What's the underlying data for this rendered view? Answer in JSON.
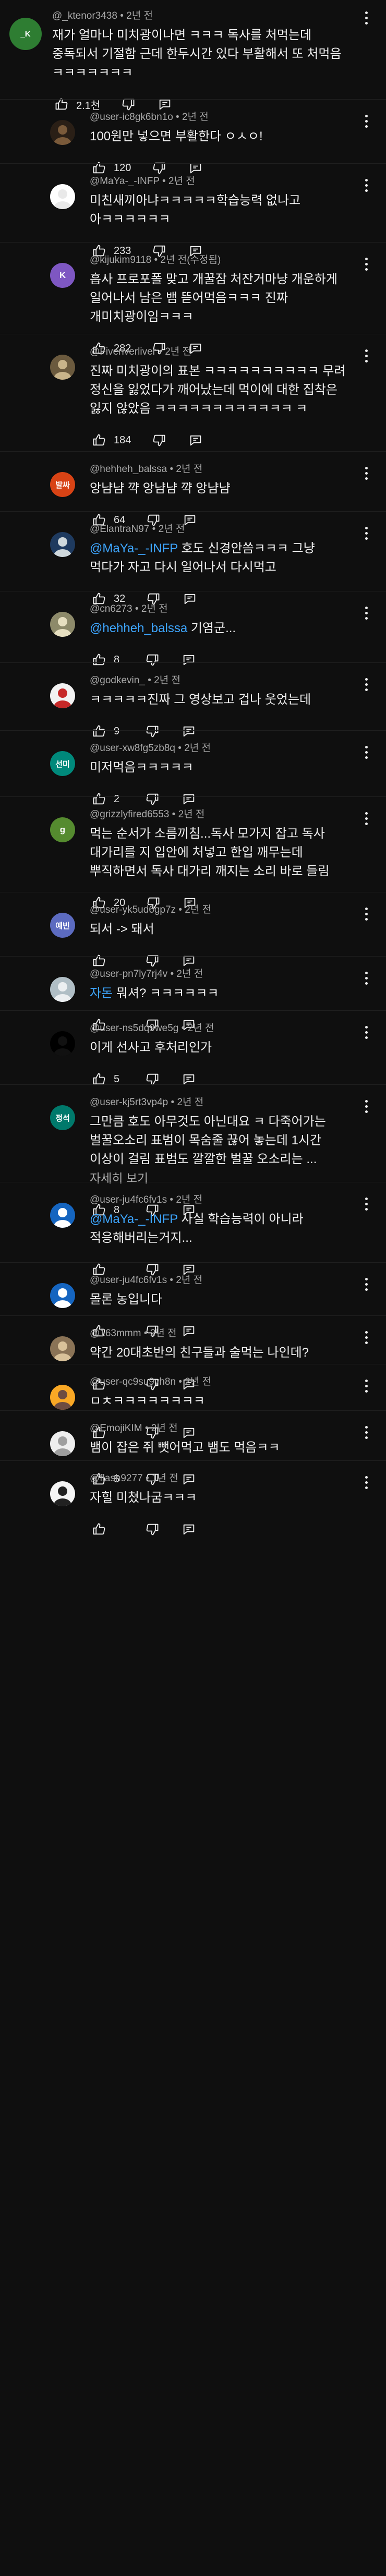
{
  "ui": {
    "bullet": "•",
    "colors": {
      "background": "#0f0f0f",
      "text": "#f1f1f1",
      "meta": "#aaaaaa",
      "mention": "#3ea6ff"
    },
    "icons": {
      "like": "thumb-up-icon",
      "dislike": "thumb-down-icon",
      "reply": "reply-icon",
      "more": "more-vert-icon"
    }
  },
  "comments": [
    {
      "author": "@_ktenor3438",
      "time": "2년 전",
      "top": true,
      "avatar": {
        "type": "initials",
        "text": "_K",
        "color": "#2e7d32"
      },
      "segments": [
        {
          "t": "재가 얼마나 미치광이나면 ㅋㅋㅋ 독사를 처먹는데 중독되서 기절함 근데 한두시간 있다 부활해서 또 처먹음 ㅋㅋㅋㅋㅋㅋㅋ"
        }
      ],
      "likes": "2.1천"
    },
    {
      "author": "@user-ic8gk6bn1o",
      "time": "2년 전",
      "avatar": {
        "type": "image",
        "bg": "#2a1f16",
        "fg": "#7a5a3a"
      },
      "segments": [
        {
          "t": "100원만 넣으면 부활한다 ㅇㅅㅇ!"
        }
      ],
      "likes": "120"
    },
    {
      "author": "@MaYa-_-INFP",
      "time": "2년 전",
      "avatar": {
        "type": "image",
        "bg": "#ffffff",
        "fg": "#e9e9e9"
      },
      "segments": [
        {
          "t": "미친새끼아냐ㅋㅋㅋㅋㅋ학습능력 없나고 아ㅋㅋㅋㅋㅋㅋ"
        }
      ],
      "likes": "233"
    },
    {
      "author": "@kijukim9118",
      "time": "2년 전(수정됨)",
      "avatar": {
        "type": "initials",
        "text": "K",
        "color": "#7e57c2"
      },
      "segments": [
        {
          "t": "흡사 프로포폴 맞고 개꿀잠 처잔거마냥 개운하게 일어나서 남은 뱀 뜯어먹음ㅋㅋㅋ 진짜 개미치광이임ㅋㅋㅋ"
        }
      ],
      "likes": "282"
    },
    {
      "author": "@Fiveriverliver",
      "time": "2년 전",
      "avatar": {
        "type": "image",
        "bg": "#6b5a3e",
        "fg": "#c9b48a"
      },
      "segments": [
        {
          "t": "진짜 미치광이의 표본 ㅋㅋㅋㅋㅋㅋㅋㅋㅋㅋ 무려 정신을 잃었다가 깨어났는데 먹이에 대한 집착은 잃지 않았음 ㅋㅋㅋㅋㅋㅋㅋㅋㅋㅋㅋㅋ ㅋ"
        }
      ],
      "likes": "184"
    },
    {
      "author": "@hehheh_balssa",
      "time": "2년 전",
      "avatar": {
        "type": "initials",
        "text": "발싸",
        "color": "#d84315"
      },
      "segments": [
        {
          "t": "앙냠냠 꺅 앙냠냠 꺅 앙냠냠"
        }
      ],
      "likes": "64"
    },
    {
      "author": "@ElantraN97",
      "time": "2년 전",
      "avatar": {
        "type": "image",
        "bg": "#1e3a5f",
        "fg": "#cfd8dc"
      },
      "segments": [
        {
          "t": "@MaYa-_-INFP",
          "m": true
        },
        {
          "t": " 호도 신경안씀ㅋㅋㅋ 그냥 먹다가 자고 다시 일어나서 다시먹고"
        }
      ],
      "likes": "32"
    },
    {
      "author": "@cn6273",
      "time": "2년 전",
      "avatar": {
        "type": "image",
        "bg": "#8d8a6a",
        "fg": "#e6dfc0"
      },
      "segments": [
        {
          "t": "@hehheh_balssa",
          "m": true
        },
        {
          "t": " 기염군..."
        }
      ],
      "likes": "8"
    },
    {
      "author": "@godkevin_",
      "time": "2년 전",
      "avatar": {
        "type": "image",
        "bg": "#f2f2f2",
        "fg": "#c62828"
      },
      "segments": [
        {
          "t": "ㅋㅋㅋㅋㅋ진짜 그 영상보고 겁나 웃었는데"
        }
      ],
      "likes": "9"
    },
    {
      "author": "@user-xw8fg5zb8q",
      "time": "2년 전",
      "avatar": {
        "type": "initials",
        "text": "선미",
        "color": "#00897b"
      },
      "segments": [
        {
          "t": "미저먹음ㅋㅋㅋㅋㅋ"
        }
      ],
      "likes": "2"
    },
    {
      "author": "@grizzlyfired6553",
      "time": "2년 전",
      "avatar": {
        "type": "initials",
        "text": "g",
        "color": "#558b2f"
      },
      "segments": [
        {
          "t": "먹는 순서가 소름끼침...독사 모가지 잡고 독사 대가리를 지 입안에 처넣고 한입 깨무는데 뿌직하면서 독사  대가리 깨지는 소리 바로 들림"
        }
      ],
      "likes": "20"
    },
    {
      "author": "@user-yk5ud6gp7z",
      "time": "2년 전",
      "avatar": {
        "type": "initials",
        "text": "예빈",
        "color": "#5c6bc0"
      },
      "segments": [
        {
          "t": "되서 -> 돼서"
        }
      ],
      "likes": ""
    },
    {
      "author": "@user-pn7ly7rj4v",
      "time": "2년 전",
      "avatar": {
        "type": "image",
        "bg": "#b0bec5",
        "fg": "#eceff1"
      },
      "segments": [
        {
          "t": " 자돈",
          "m": true
        },
        {
          "t": " 뭐셔? ㅋㅋㅋㅋㅋㅋ"
        }
      ],
      "likes": ""
    },
    {
      "author": "@user-ns5dq9we5g",
      "time": "2년 전",
      "avatar": {
        "type": "image",
        "bg": "#000000",
        "fg": "#111111"
      },
      "segments": [
        {
          "t": "이게 선사고 후처리인가"
        }
      ],
      "likes": "5"
    },
    {
      "author": "@user-kj5rt3vp4p",
      "time": "2년 전",
      "avatar": {
        "type": "initials",
        "text": "정석",
        "color": "#00796b"
      },
      "segments": [
        {
          "t": "그만큼 호도 아무것도 아닌대요 ㅋ 다죽어가는 벌꿀오소리 표범이 목숨줄 끊어 놓는데 1시간 이상이 걸림 표범도 깔깔한 벌꿀 오소리는 ... "
        },
        {
          "t": "자세히 보기",
          "more": true
        }
      ],
      "likes": "8"
    },
    {
      "author": "@user-ju4fc6fv1s",
      "time": "2년 전",
      "avatar": {
        "type": "image",
        "bg": "#1565c0",
        "fg": "#ffffff"
      },
      "segments": [
        {
          "t": "@MaYa-_-INFP",
          "m": true
        },
        {
          "t": " 사실 학습능력이 아니라 적응해버리는거지..."
        }
      ],
      "likes": ""
    },
    {
      "author": "@user-ju4fc6fv1s",
      "time": "2년 전",
      "avatar": {
        "type": "image",
        "bg": "#1565c0",
        "fg": "#ffffff"
      },
      "segments": [
        {
          "t": "몰론 농입니다"
        }
      ],
      "likes": ""
    },
    {
      "author": "@163mmm",
      "time": "2년 전",
      "avatar": {
        "type": "image",
        "bg": "#8a7356",
        "fg": "#d9c29a"
      },
      "segments": [
        {
          "t": "약간 20대초반의 친구들과 술먹는 나인데?"
        }
      ],
      "likes": ""
    },
    {
      "author": "@user-qc9su9vh8n",
      "time": "2년 전",
      "avatar": {
        "type": "image",
        "bg": "#f9a825",
        "fg": "#6d4c41"
      },
      "segments": [
        {
          "t": "ㅁㅊㅋㅋㅋㅋㅋㅋㅋㅋ"
        }
      ],
      "likes": ""
    },
    {
      "author": "@EmojiKIM",
      "time": "2년 전",
      "avatar": {
        "type": "image",
        "bg": "#eeeeee",
        "fg": "#9e9e9e"
      },
      "segments": [
        {
          "t": "뱀이 잡은 쥐 뺏어먹고 뱀도 먹음ㅋㅋ"
        }
      ],
      "likes": "5"
    },
    {
      "author": "@flash9277",
      "time": "1년 전",
      "avatar": {
        "type": "image",
        "bg": "#f5f5f5",
        "fg": "#212121"
      },
      "segments": [
        {
          "t": "자힐 미쳤나굼ㅋㅋㅋ"
        }
      ],
      "likes": ""
    }
  ]
}
